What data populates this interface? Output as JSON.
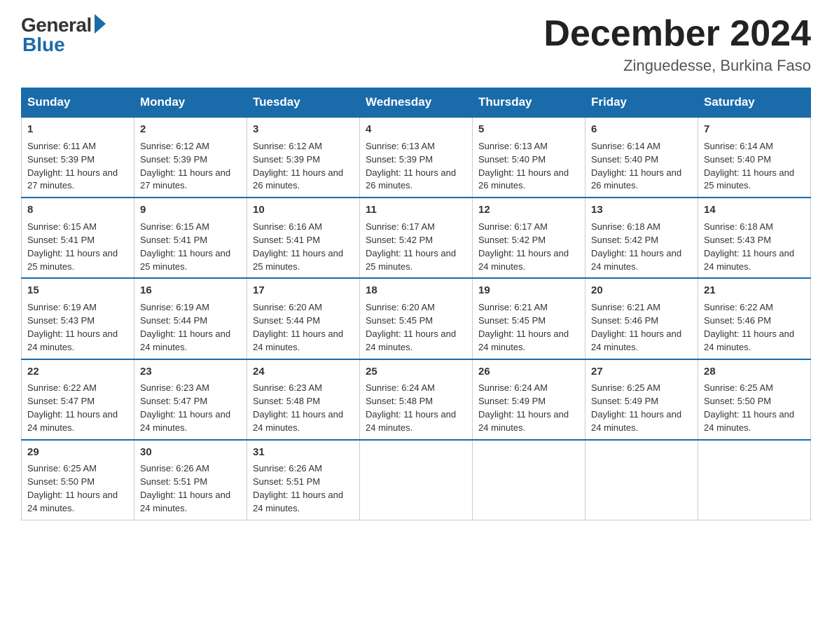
{
  "logo": {
    "general": "General",
    "blue": "Blue"
  },
  "title": "December 2024",
  "subtitle": "Zinguedesse, Burkina Faso",
  "headers": [
    "Sunday",
    "Monday",
    "Tuesday",
    "Wednesday",
    "Thursday",
    "Friday",
    "Saturday"
  ],
  "weeks": [
    [
      {
        "day": "1",
        "sunrise": "6:11 AM",
        "sunset": "5:39 PM",
        "daylight": "11 hours and 27 minutes."
      },
      {
        "day": "2",
        "sunrise": "6:12 AM",
        "sunset": "5:39 PM",
        "daylight": "11 hours and 27 minutes."
      },
      {
        "day": "3",
        "sunrise": "6:12 AM",
        "sunset": "5:39 PM",
        "daylight": "11 hours and 26 minutes."
      },
      {
        "day": "4",
        "sunrise": "6:13 AM",
        "sunset": "5:39 PM",
        "daylight": "11 hours and 26 minutes."
      },
      {
        "day": "5",
        "sunrise": "6:13 AM",
        "sunset": "5:40 PM",
        "daylight": "11 hours and 26 minutes."
      },
      {
        "day": "6",
        "sunrise": "6:14 AM",
        "sunset": "5:40 PM",
        "daylight": "11 hours and 26 minutes."
      },
      {
        "day": "7",
        "sunrise": "6:14 AM",
        "sunset": "5:40 PM",
        "daylight": "11 hours and 25 minutes."
      }
    ],
    [
      {
        "day": "8",
        "sunrise": "6:15 AM",
        "sunset": "5:41 PM",
        "daylight": "11 hours and 25 minutes."
      },
      {
        "day": "9",
        "sunrise": "6:15 AM",
        "sunset": "5:41 PM",
        "daylight": "11 hours and 25 minutes."
      },
      {
        "day": "10",
        "sunrise": "6:16 AM",
        "sunset": "5:41 PM",
        "daylight": "11 hours and 25 minutes."
      },
      {
        "day": "11",
        "sunrise": "6:17 AM",
        "sunset": "5:42 PM",
        "daylight": "11 hours and 25 minutes."
      },
      {
        "day": "12",
        "sunrise": "6:17 AM",
        "sunset": "5:42 PM",
        "daylight": "11 hours and 24 minutes."
      },
      {
        "day": "13",
        "sunrise": "6:18 AM",
        "sunset": "5:42 PM",
        "daylight": "11 hours and 24 minutes."
      },
      {
        "day": "14",
        "sunrise": "6:18 AM",
        "sunset": "5:43 PM",
        "daylight": "11 hours and 24 minutes."
      }
    ],
    [
      {
        "day": "15",
        "sunrise": "6:19 AM",
        "sunset": "5:43 PM",
        "daylight": "11 hours and 24 minutes."
      },
      {
        "day": "16",
        "sunrise": "6:19 AM",
        "sunset": "5:44 PM",
        "daylight": "11 hours and 24 minutes."
      },
      {
        "day": "17",
        "sunrise": "6:20 AM",
        "sunset": "5:44 PM",
        "daylight": "11 hours and 24 minutes."
      },
      {
        "day": "18",
        "sunrise": "6:20 AM",
        "sunset": "5:45 PM",
        "daylight": "11 hours and 24 minutes."
      },
      {
        "day": "19",
        "sunrise": "6:21 AM",
        "sunset": "5:45 PM",
        "daylight": "11 hours and 24 minutes."
      },
      {
        "day": "20",
        "sunrise": "6:21 AM",
        "sunset": "5:46 PM",
        "daylight": "11 hours and 24 minutes."
      },
      {
        "day": "21",
        "sunrise": "6:22 AM",
        "sunset": "5:46 PM",
        "daylight": "11 hours and 24 minutes."
      }
    ],
    [
      {
        "day": "22",
        "sunrise": "6:22 AM",
        "sunset": "5:47 PM",
        "daylight": "11 hours and 24 minutes."
      },
      {
        "day": "23",
        "sunrise": "6:23 AM",
        "sunset": "5:47 PM",
        "daylight": "11 hours and 24 minutes."
      },
      {
        "day": "24",
        "sunrise": "6:23 AM",
        "sunset": "5:48 PM",
        "daylight": "11 hours and 24 minutes."
      },
      {
        "day": "25",
        "sunrise": "6:24 AM",
        "sunset": "5:48 PM",
        "daylight": "11 hours and 24 minutes."
      },
      {
        "day": "26",
        "sunrise": "6:24 AM",
        "sunset": "5:49 PM",
        "daylight": "11 hours and 24 minutes."
      },
      {
        "day": "27",
        "sunrise": "6:25 AM",
        "sunset": "5:49 PM",
        "daylight": "11 hours and 24 minutes."
      },
      {
        "day": "28",
        "sunrise": "6:25 AM",
        "sunset": "5:50 PM",
        "daylight": "11 hours and 24 minutes."
      }
    ],
    [
      {
        "day": "29",
        "sunrise": "6:25 AM",
        "sunset": "5:50 PM",
        "daylight": "11 hours and 24 minutes."
      },
      {
        "day": "30",
        "sunrise": "6:26 AM",
        "sunset": "5:51 PM",
        "daylight": "11 hours and 24 minutes."
      },
      {
        "day": "31",
        "sunrise": "6:26 AM",
        "sunset": "5:51 PM",
        "daylight": "11 hours and 24 minutes."
      },
      null,
      null,
      null,
      null
    ]
  ]
}
